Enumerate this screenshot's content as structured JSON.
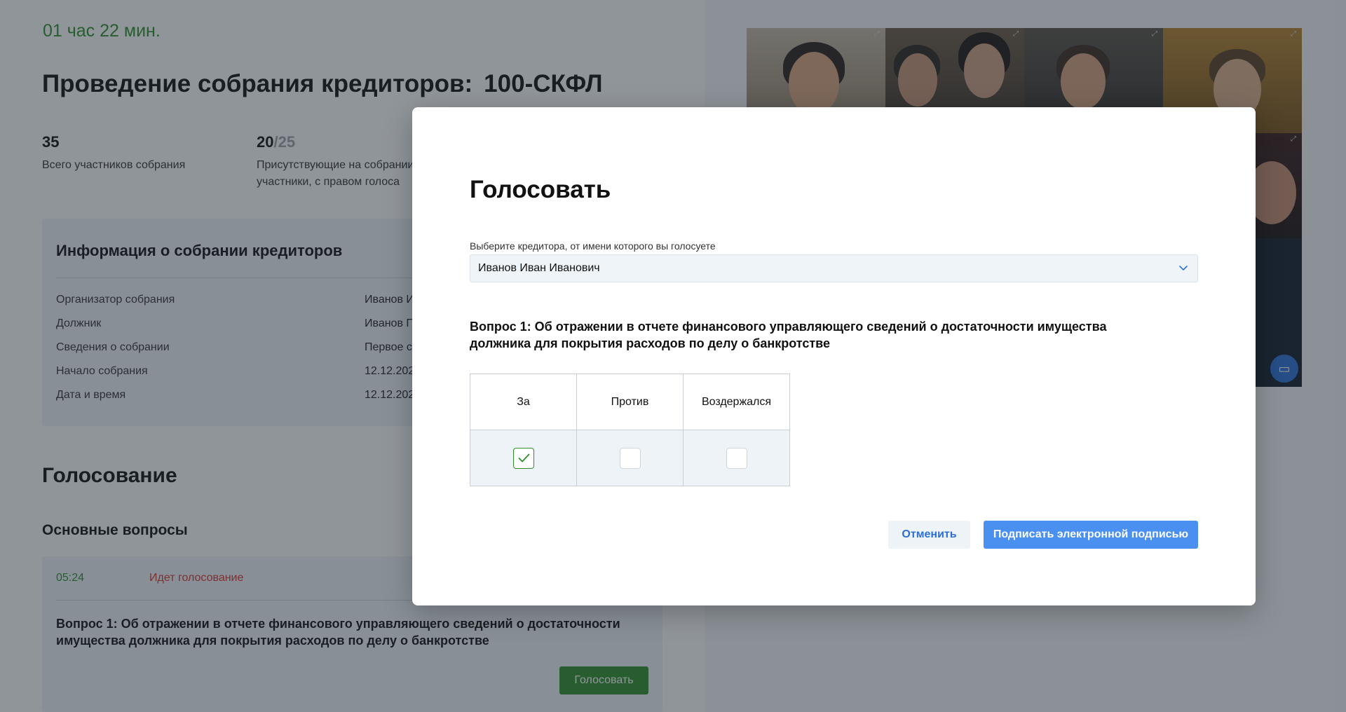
{
  "timer": "01 час 22 мин.",
  "page_title": "Проведение собрания кредиторов:",
  "meeting_code": "100-СКФЛ",
  "stats": [
    {
      "number": "35",
      "of": "",
      "label": "Всего участников собрания"
    },
    {
      "number": "20",
      "of": "/25",
      "label": "Присутствующие на собрании участники, с правом голоса"
    }
  ],
  "info": {
    "title": "Информация о собрании кредиторов",
    "rows": [
      {
        "key": "Организатор собрания",
        "value": "Иванов И"
      },
      {
        "key": "Должник",
        "value": "Иванов П"
      },
      {
        "key": "Сведения о собрании",
        "value": "Первое с"
      },
      {
        "key": "Начало собрания",
        "value": "12.12.202"
      },
      {
        "key": "Дата и время",
        "value": "12.12.202"
      }
    ]
  },
  "voting": {
    "title": "Голосование",
    "subtitle": "Основные вопросы",
    "question_card": {
      "time": "05:24",
      "status": "Идет голосование",
      "text": "Вопрос 1: Об отражении в отчете финансового управляющего сведений о достаточности имущества должника для покрытия расходов по делу о банкротстве",
      "vote_button": "Голосовать"
    }
  },
  "modal": {
    "title": "Голосовать",
    "creditor_label": "Выберите кредитора, от имени которого вы голосуете",
    "creditor_value": "Иванов Иван Иванович",
    "question": "Вопрос 1: Об отражении в отчете финансового управляющего сведений о достаточности имущества должника для покрытия расходов по делу о банкротстве",
    "options": [
      {
        "label": "За",
        "checked": true
      },
      {
        "label": "Против",
        "checked": false
      },
      {
        "label": "Воздержался",
        "checked": false
      }
    ],
    "cancel_label": "Отменить",
    "sign_label": "Подписать электронной подписью"
  },
  "colors": {
    "accent_green": "#2f8f2a",
    "status_red": "#d9342b",
    "primary_blue": "#4a90f0",
    "link_blue": "#2b6fd6"
  },
  "icons": {
    "chevron": "chevron-down-icon",
    "check": "check-icon",
    "screen_share": "screen-share-icon",
    "expand": "expand-icon"
  }
}
